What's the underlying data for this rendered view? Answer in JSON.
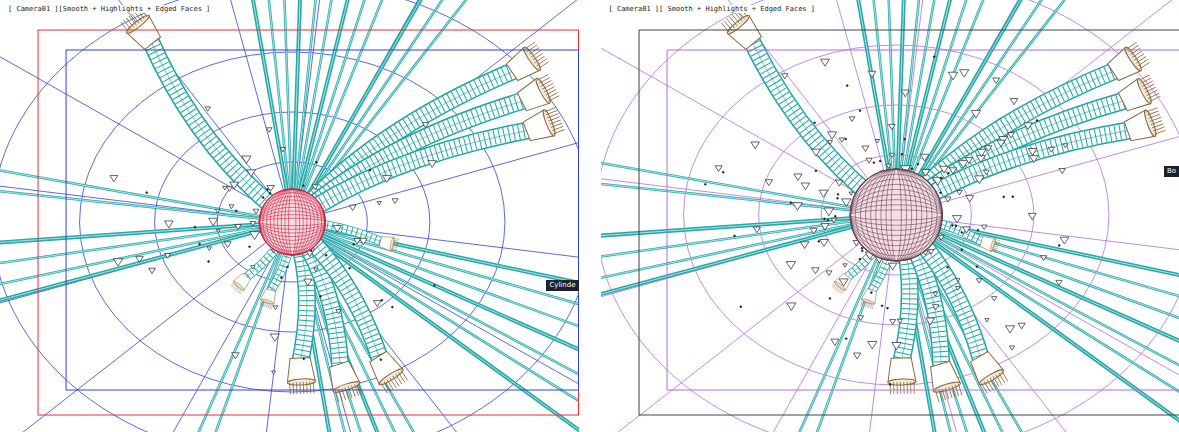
{
  "viewports": [
    {
      "label": "[ Camera01 ][Smooth + Highlights + Edged Faces ]",
      "tooltip": "Cylinde",
      "kind": "mesh"
    },
    {
      "label": "[ Camera01 ][ Smooth + Highlights + Edged Faces ]",
      "tooltip": "Bo",
      "kind": "particles"
    }
  ]
}
